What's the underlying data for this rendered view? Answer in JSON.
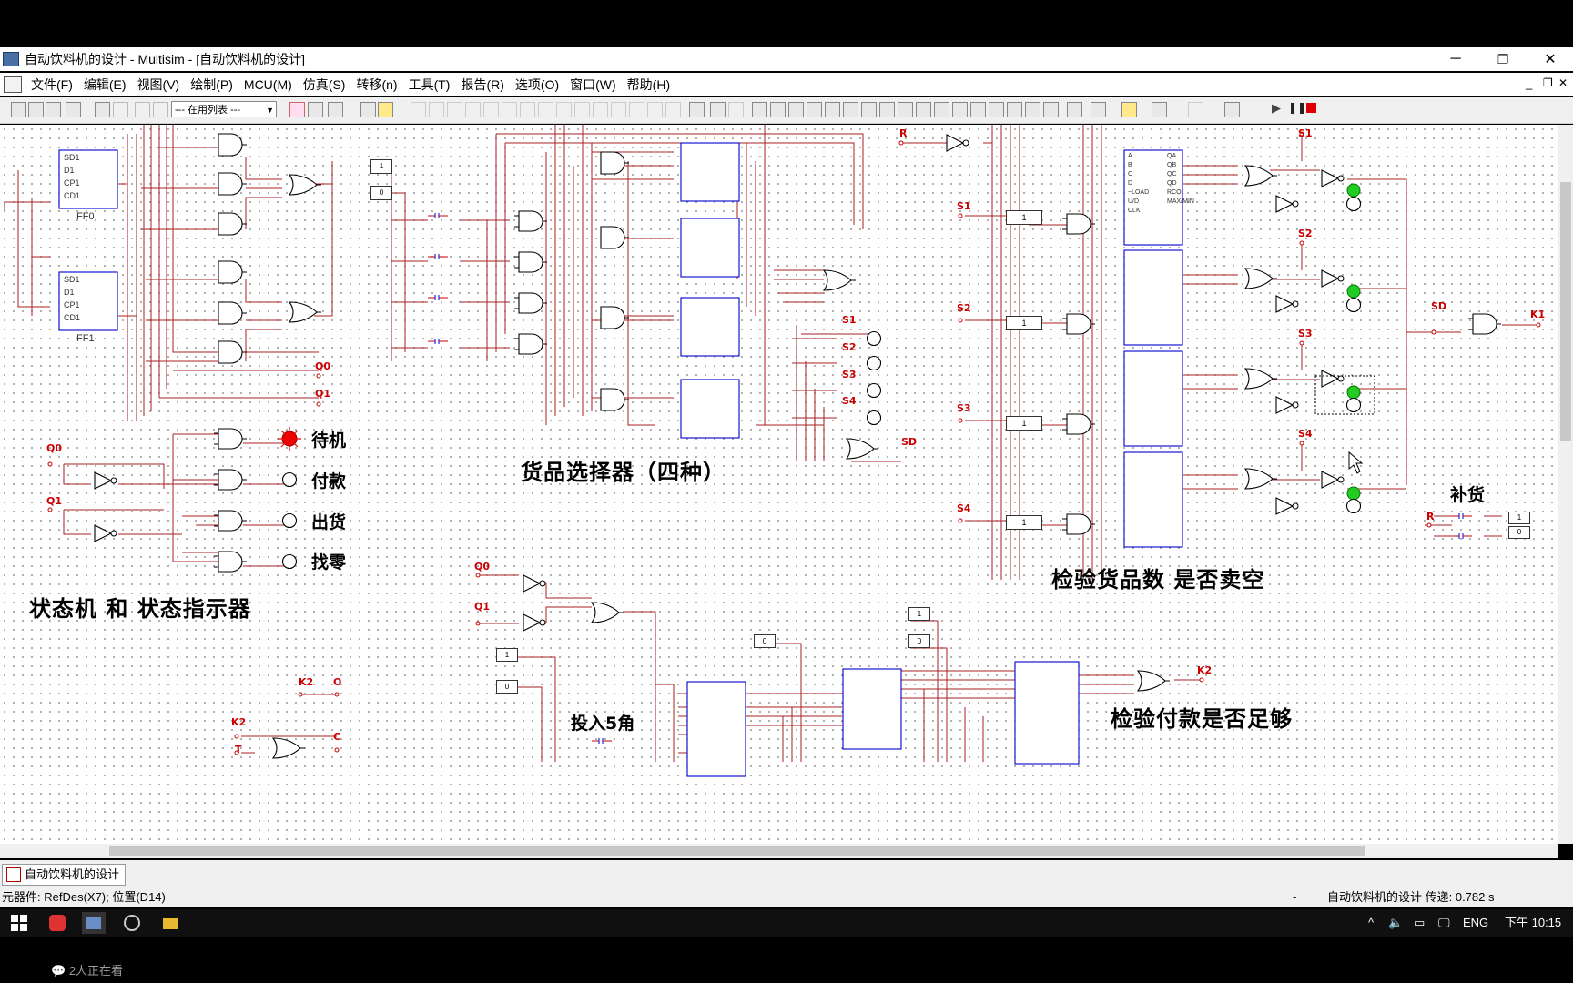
{
  "window": {
    "title": "自动饮料机的设计 - Multisim - [自动饮料机的设计]",
    "controls": [
      "─",
      "❐",
      "✕"
    ],
    "doc_controls": [
      "_",
      "❐",
      "✕"
    ]
  },
  "menu": [
    "文件(F)",
    "编辑(E)",
    "视图(V)",
    "绘制(P)",
    "MCU(M)",
    "仿真(S)",
    "转移(n)",
    "工具(T)",
    "报告(R)",
    "选项(O)",
    "窗口(W)",
    "帮助(H)"
  ],
  "toolbar": {
    "in_use_list": "--- 在用列表 ---"
  },
  "schematic": {
    "flipflops": [
      "FF0",
      "FF1"
    ],
    "nets": {
      "q0": "Q0",
      "q1": "Q1",
      "k1": "K1",
      "k2": "K2",
      "o": "O",
      "c": "C",
      "t": "T",
      "r": "R",
      "sd": "SD",
      "s1": "S1",
      "s2": "S2",
      "s3": "S3",
      "s4": "S4"
    },
    "state_labels": [
      "待机",
      "付款",
      "出货",
      "找零"
    ],
    "titles": {
      "state_machine": "状态机  和  状态指示器",
      "selector": "货品选择器（四种）",
      "check_stock": "检验货品数  是否卖空",
      "restock": "补货",
      "insert": "投入5角",
      "check_payment": "检验付款是否足够"
    },
    "key_labels": {
      "one": "1",
      "zero": "0"
    },
    "counter_pins_left": [
      "A",
      "B",
      "C",
      "D",
      "",
      "~LOAD",
      "U/D",
      "CLK"
    ],
    "counter_pins_right": [
      "QA",
      "QB",
      "QC",
      "QD",
      "",
      "RCO",
      "MAX/MIN"
    ],
    "ff_pins": [
      "SD1",
      "D1",
      "CP1",
      "CD1"
    ]
  },
  "tabs": [
    "自动饮料机的设计"
  ],
  "status": {
    "left": "元器件: RefDes(X7); 位置(D14)",
    "dash": "-",
    "right": "自动饮料机的设计 传递: 0.782 s"
  },
  "taskbar": {
    "lang": "ENG",
    "time": "下午 10:15"
  },
  "overlay": {
    "viewers": "2人正在看"
  }
}
